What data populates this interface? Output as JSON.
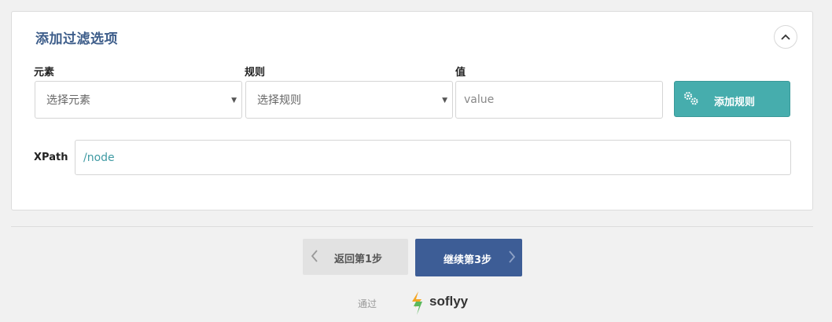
{
  "panel": {
    "title": "添加过滤选项"
  },
  "fields": {
    "element": {
      "label": "元素",
      "selected": "选择元素"
    },
    "rule": {
      "label": "规则",
      "selected": "选择规则"
    },
    "value": {
      "label": "值",
      "placeholder": "value"
    }
  },
  "add_rule_button": {
    "label": "添加规则"
  },
  "xpath": {
    "label": "XPath",
    "value": "/node"
  },
  "nav": {
    "back_label": "返回第1步",
    "next_label": "继续第3步"
  },
  "footer": {
    "via": "通过",
    "brand": "soflyy"
  },
  "colors": {
    "title": "#3d5d8a",
    "add_rule": "#46adad",
    "next": "#3d5d96",
    "back": "#e2e2e2"
  }
}
